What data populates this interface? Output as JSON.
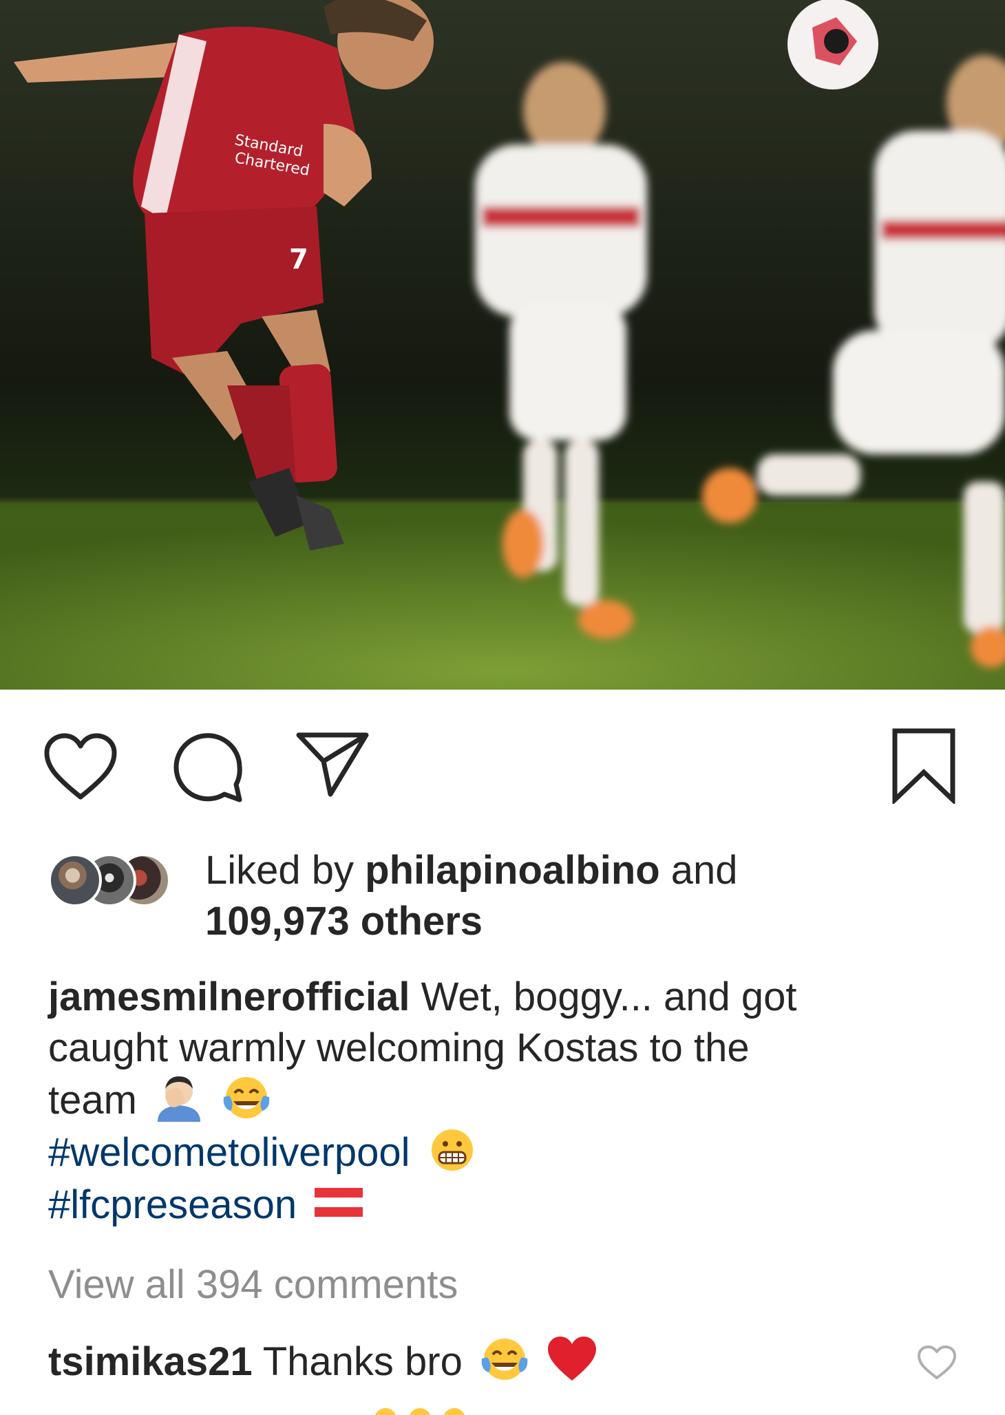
{
  "post": {
    "image_alt": "Footballer heading the ball during a preseason match",
    "shirt_text": "Standard Chartered"
  },
  "actions": {
    "like_icon": "heart-icon",
    "comment_icon": "comment-icon",
    "share_icon": "paper-plane-icon",
    "save_icon": "bookmark-icon"
  },
  "likes": {
    "prefix": "Liked by",
    "user": "philapinoalbino",
    "middle": "and",
    "others": "109,973 others"
  },
  "caption": {
    "username": "jamesmilnerofficial",
    "line1": "Wet, boggy... and got",
    "line2": "caught warmly welcoming Kostas to the",
    "line3": "team",
    "hashtag1": "#welcometoliverpool",
    "hashtag2": "#lfcpreseason"
  },
  "view_all": "View all 394 comments",
  "comment": {
    "username": "tsimikas21",
    "text": "Thanks bro"
  },
  "colors": {
    "hashtag": "#00376b",
    "muted": "#8e8e8e",
    "liverpool_red": "#b3202c"
  }
}
